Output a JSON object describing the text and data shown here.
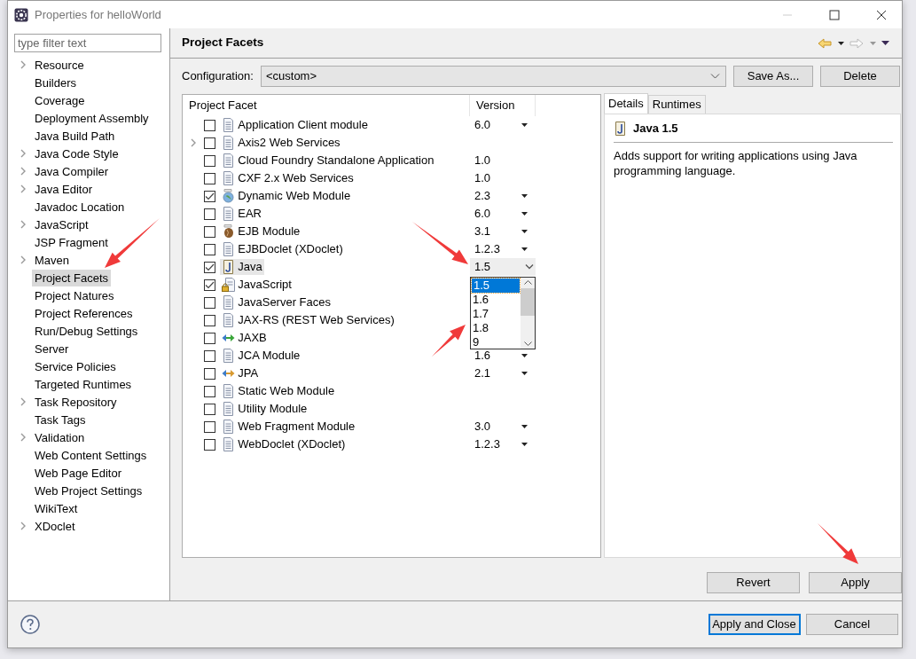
{
  "window": {
    "title": "Properties for helloWorld"
  },
  "filter": {
    "placeholder": "type filter text"
  },
  "tree": [
    {
      "label": "Resource",
      "expandable": true,
      "selected": false
    },
    {
      "label": "Builders",
      "expandable": false,
      "selected": false
    },
    {
      "label": "Coverage",
      "expandable": false,
      "selected": false
    },
    {
      "label": "Deployment Assembly",
      "expandable": false,
      "selected": false
    },
    {
      "label": "Java Build Path",
      "expandable": false,
      "selected": false
    },
    {
      "label": "Java Code Style",
      "expandable": true,
      "selected": false
    },
    {
      "label": "Java Compiler",
      "expandable": true,
      "selected": false
    },
    {
      "label": "Java Editor",
      "expandable": true,
      "selected": false
    },
    {
      "label": "Javadoc Location",
      "expandable": false,
      "selected": false
    },
    {
      "label": "JavaScript",
      "expandable": true,
      "selected": false
    },
    {
      "label": "JSP Fragment",
      "expandable": false,
      "selected": false
    },
    {
      "label": "Maven",
      "expandable": true,
      "selected": false
    },
    {
      "label": "Project Facets",
      "expandable": false,
      "selected": true
    },
    {
      "label": "Project Natures",
      "expandable": false,
      "selected": false
    },
    {
      "label": "Project References",
      "expandable": false,
      "selected": false
    },
    {
      "label": "Run/Debug Settings",
      "expandable": false,
      "selected": false
    },
    {
      "label": "Server",
      "expandable": false,
      "selected": false
    },
    {
      "label": "Service Policies",
      "expandable": false,
      "selected": false
    },
    {
      "label": "Targeted Runtimes",
      "expandable": false,
      "selected": false
    },
    {
      "label": "Task Repository",
      "expandable": true,
      "selected": false
    },
    {
      "label": "Task Tags",
      "expandable": false,
      "selected": false
    },
    {
      "label": "Validation",
      "expandable": true,
      "selected": false
    },
    {
      "label": "Web Content Settings",
      "expandable": false,
      "selected": false
    },
    {
      "label": "Web Page Editor",
      "expandable": false,
      "selected": false
    },
    {
      "label": "Web Project Settings",
      "expandable": false,
      "selected": false
    },
    {
      "label": "WikiText",
      "expandable": false,
      "selected": false
    },
    {
      "label": "XDoclet",
      "expandable": true,
      "selected": false
    }
  ],
  "page_title": "Project Facets",
  "configuration": {
    "label": "Configuration:",
    "value": "<custom>"
  },
  "config_buttons": [
    "Save As...",
    "Delete"
  ],
  "facets": {
    "columns": [
      "Project Facet",
      "Version"
    ],
    "rows": [
      {
        "name": "Application Client module",
        "kind": "page",
        "checked": false,
        "expandable": false,
        "selected": false,
        "version": "6.0",
        "dropdown": true
      },
      {
        "name": "Axis2 Web Services",
        "kind": "page",
        "checked": false,
        "expandable": true,
        "selected": false
      },
      {
        "name": "Cloud Foundry Standalone Application",
        "kind": "page",
        "checked": false,
        "expandable": false,
        "selected": false,
        "version": "1.0",
        "dropdown": false
      },
      {
        "name": "CXF 2.x Web Services",
        "kind": "page",
        "checked": false,
        "expandable": false,
        "selected": false,
        "version": "1.0",
        "dropdown": false
      },
      {
        "name": "Dynamic Web Module",
        "kind": "globe",
        "checked": true,
        "expandable": false,
        "selected": false,
        "version": "2.3",
        "dropdown": true
      },
      {
        "name": "EAR",
        "kind": "page",
        "checked": false,
        "expandable": false,
        "selected": false,
        "version": "6.0",
        "dropdown": true
      },
      {
        "name": "EJB Module",
        "kind": "bean",
        "checked": false,
        "expandable": false,
        "selected": false,
        "version": "3.1",
        "dropdown": true
      },
      {
        "name": "EJBDoclet (XDoclet)",
        "kind": "page",
        "checked": false,
        "expandable": false,
        "selected": false,
        "version": "1.2.3",
        "dropdown": true
      },
      {
        "name": "Java",
        "kind": "java",
        "checked": true,
        "expandable": false,
        "selected": true,
        "version": "1.5",
        "dropdown": true
      },
      {
        "name": "JavaScript",
        "kind": "locked",
        "checked": true,
        "expandable": false,
        "selected": false
      },
      {
        "name": "JavaServer Faces",
        "kind": "page",
        "checked": false,
        "expandable": false,
        "selected": false
      },
      {
        "name": "JAX-RS (REST Web Services)",
        "kind": "page",
        "checked": false,
        "expandable": false,
        "selected": false
      },
      {
        "name": "JAXB",
        "kind": "green-arrows",
        "checked": false,
        "expandable": false,
        "selected": false
      },
      {
        "name": "JCA Module",
        "kind": "page",
        "checked": false,
        "expandable": false,
        "selected": false,
        "version": "1.6",
        "dropdown": true
      },
      {
        "name": "JPA",
        "kind": "orange-arrows",
        "checked": false,
        "expandable": false,
        "selected": false,
        "version": "2.1",
        "dropdown": true
      },
      {
        "name": "Static Web Module",
        "kind": "page",
        "checked": false,
        "expandable": false,
        "selected": false
      },
      {
        "name": "Utility Module",
        "kind": "page",
        "checked": false,
        "expandable": false,
        "selected": false
      },
      {
        "name": "Web Fragment Module",
        "kind": "page",
        "checked": false,
        "expandable": false,
        "selected": false,
        "version": "3.0",
        "dropdown": true
      },
      {
        "name": "WebDoclet (XDoclet)",
        "kind": "page",
        "checked": false,
        "expandable": false,
        "selected": false,
        "version": "1.2.3",
        "dropdown": true
      }
    ]
  },
  "version_dropdown": {
    "options": [
      {
        "label": "1.5",
        "selected": true
      },
      {
        "label": "1.6",
        "selected": false
      },
      {
        "label": "1.7",
        "selected": false
      },
      {
        "label": "1.8",
        "selected": false
      },
      {
        "label": "9",
        "selected": false
      }
    ]
  },
  "details": {
    "tabs": [
      {
        "label": "Details",
        "selected": true
      },
      {
        "label": "Runtimes",
        "selected": false
      }
    ],
    "title": "Java 1.5",
    "description": "Adds support for writing applications using Java programming language."
  },
  "page_buttons": [
    "Revert",
    "Apply"
  ],
  "footer_buttons": [
    {
      "label": "Apply and Close",
      "default": true
    },
    {
      "label": "Cancel",
      "default": false
    }
  ]
}
